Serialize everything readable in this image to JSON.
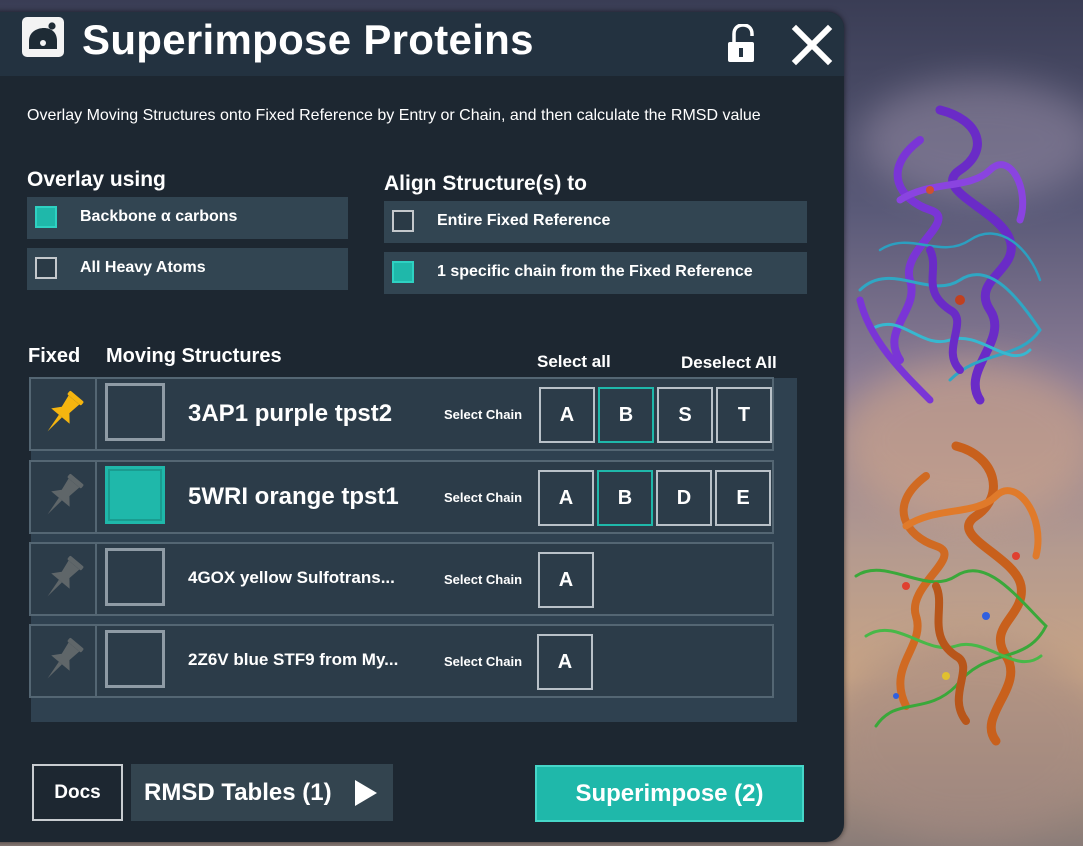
{
  "window": {
    "title": "Superimpose Proteins",
    "description": "Overlay Moving Structures onto Fixed Reference by Entry or Chain, and then calculate the RMSD value"
  },
  "overlay": {
    "label": "Overlay using",
    "options": [
      {
        "label": "Backbone α carbons",
        "checked": true
      },
      {
        "label": "All Heavy Atoms",
        "checked": false
      }
    ]
  },
  "align": {
    "label": "Align Structure(s) to",
    "options": [
      {
        "label": "Entire Fixed Reference",
        "checked": false
      },
      {
        "label": "1 specific chain from the Fixed Reference",
        "checked": true
      }
    ]
  },
  "list": {
    "fixed_header": "Fixed",
    "moving_header": "Moving Structures",
    "select_all": "Select all",
    "deselect_all": "Deselect All",
    "rows": [
      {
        "name": "3AP1 purple tpst2",
        "fixed": true,
        "moving": false,
        "select_chain": "Select Chain",
        "chains": [
          "A",
          "B",
          "S",
          "T"
        ],
        "selected_chain": "B"
      },
      {
        "name": "5WRI orange tpst1",
        "fixed": false,
        "moving": true,
        "select_chain": "Select Chain",
        "chains": [
          "A",
          "B",
          "D",
          "E"
        ],
        "selected_chain": "B"
      },
      {
        "name": "4GOX yellow Sulfotrans...",
        "fixed": false,
        "moving": false,
        "select_chain": "Select Chain",
        "chains": [
          "A"
        ],
        "selected_chain": ""
      },
      {
        "name": "2Z6V blue STF9 from My...",
        "fixed": false,
        "moving": false,
        "select_chain": "Select Chain",
        "chains": [
          "A"
        ],
        "selected_chain": ""
      }
    ]
  },
  "footer": {
    "docs": "Docs",
    "rmsd_tables": "RMSD Tables (1)",
    "superimpose": "Superimpose (2)"
  },
  "colors": {
    "accent": "#1fb8aa",
    "pin_active": "#f5b50f",
    "pin_inactive": "#5f6669"
  }
}
